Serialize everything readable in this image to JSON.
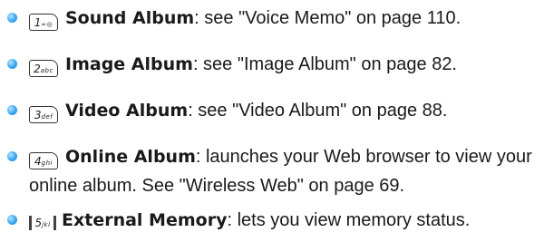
{
  "items": [
    {
      "key_digit": "1",
      "key_letters": "∞◎",
      "title": "Sound Album",
      "description": ": see \"Voice Memo\" on page 110."
    },
    {
      "key_digit": "2",
      "key_letters": "abc",
      "title": "Image Album",
      "description": ": see \"Image Album\" on page 82."
    },
    {
      "key_digit": "3",
      "key_letters": "def",
      "title": "Video Album",
      "description": ": see \"Video Album\" on page 88."
    },
    {
      "key_digit": "4",
      "key_letters": "ghi",
      "title": "Online Album",
      "description": ": launches your Web browser to view your",
      "description_line2": "online album. See \"Wireless Web\" on page 69."
    },
    {
      "key_digit": "5",
      "key_letters": "jkl",
      "title": "External Memory",
      "description": ": lets you view memory status."
    }
  ],
  "colors": {
    "bullet": "#2f9be6",
    "text": "#1a1a1a"
  }
}
